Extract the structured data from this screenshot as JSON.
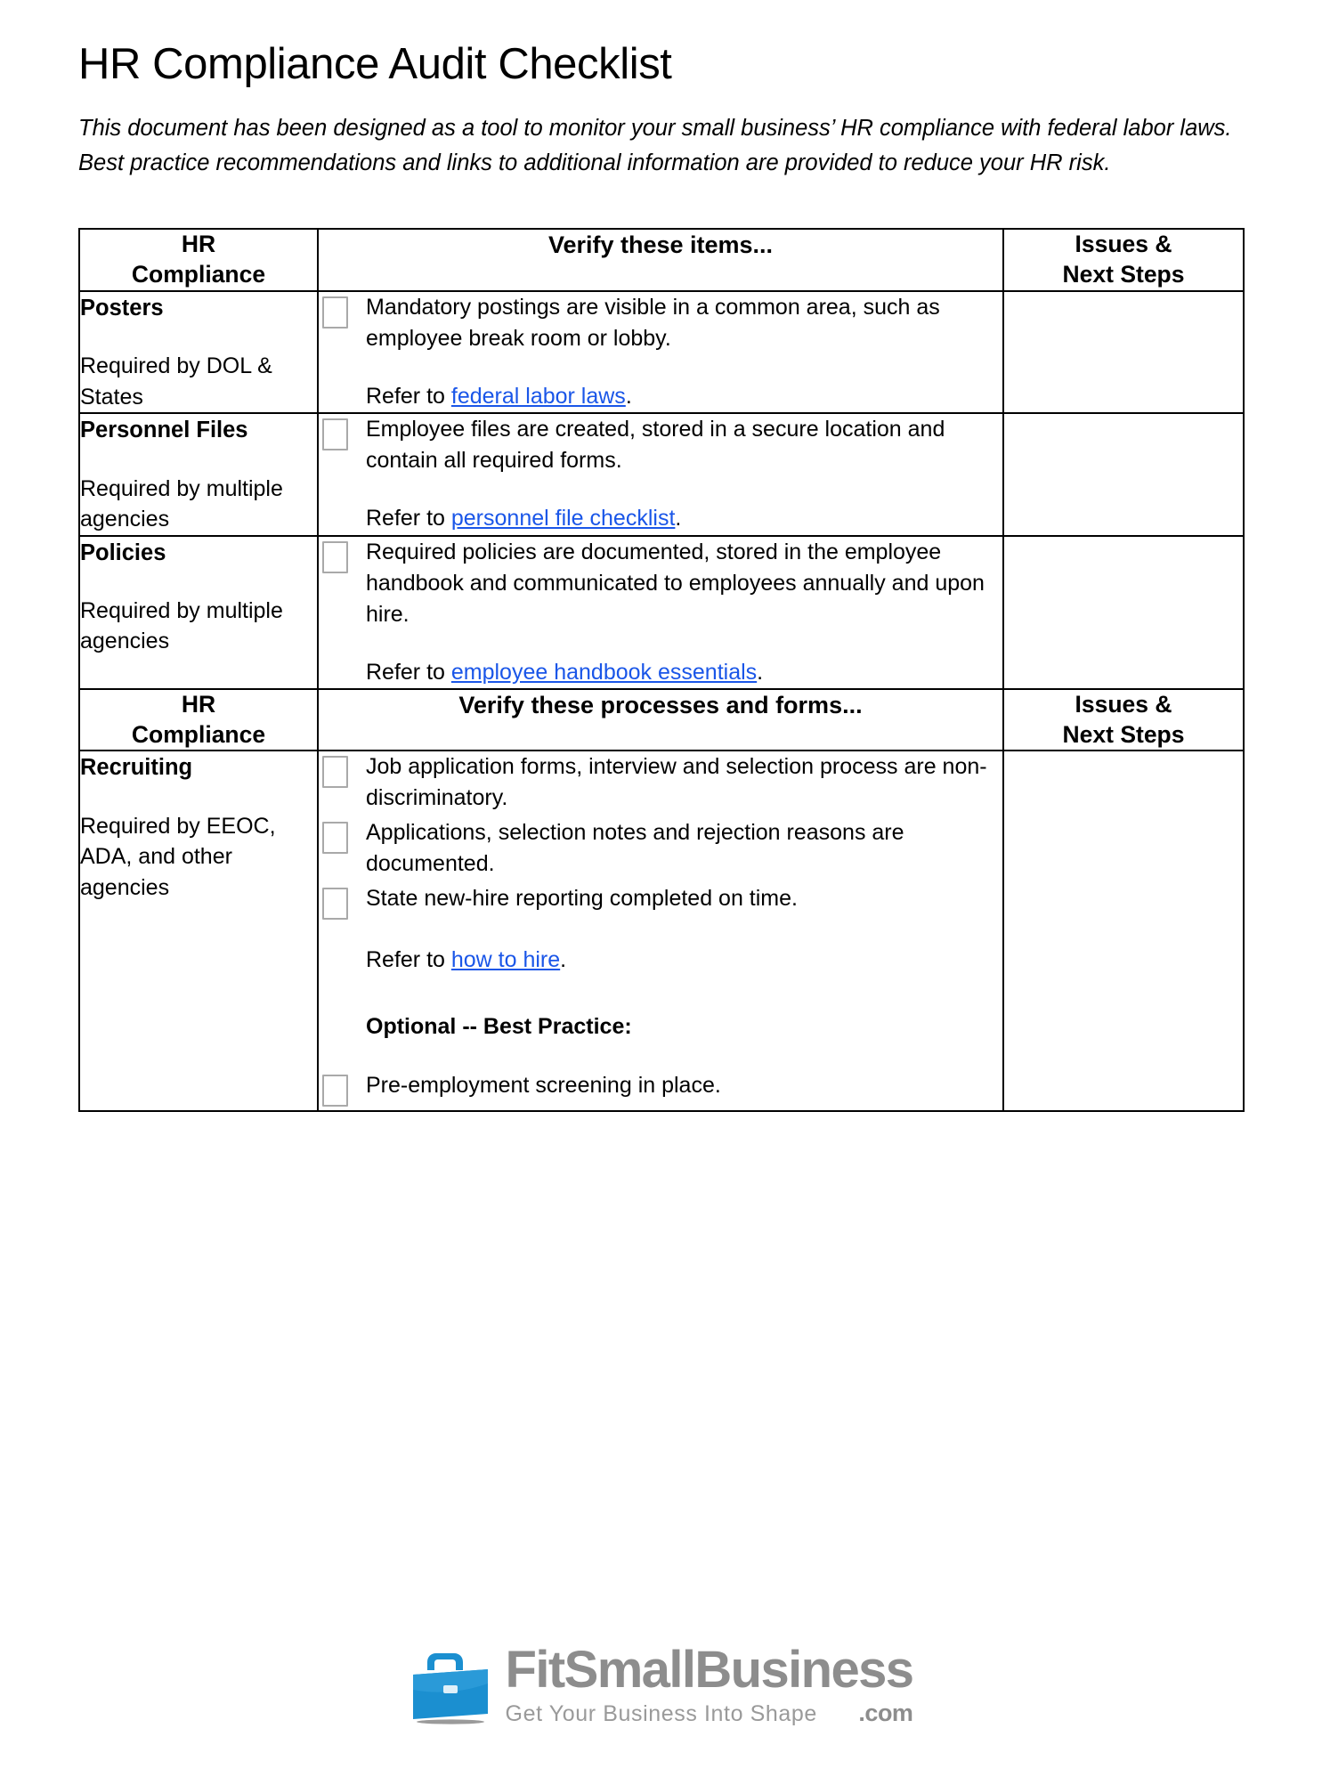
{
  "document": {
    "title": "HR Compliance Audit Checklist",
    "intro": "This document has been designed as a tool to monitor your small business’ HR compliance with federal labor laws. Best practice recommendations and links to additional information are provided to reduce your HR risk."
  },
  "table": {
    "headers_section_1": {
      "category": "HR\nCompliance",
      "category_line1": "HR",
      "category_line2": "Compliance",
      "verify": "Verify these items...",
      "issues_line1": "Issues &",
      "issues_line2": "Next Steps"
    },
    "headers_section_2": {
      "category_line1": "HR",
      "category_line2": "Compliance",
      "verify": "Verify these processes and forms...",
      "issues_line1": "Issues &",
      "issues_line2": "Next Steps"
    },
    "rows": [
      {
        "category_title": "Posters",
        "category_sub": "Required by DOL & States",
        "items": [
          "Mandatory postings are visible in a common area, such as employee break room or lobby."
        ],
        "refer_prefix": "Refer to ",
        "refer_link": "federal labor laws",
        "refer_suffix": "."
      },
      {
        "category_title": "Personnel Files",
        "category_sub": "Required by multiple agencies",
        "items": [
          "Employee files are created, stored in a secure location and contain all required forms."
        ],
        "refer_prefix": "Refer to ",
        "refer_link": "personnel file checklist",
        "refer_suffix": "."
      },
      {
        "category_title": "Policies",
        "category_sub": "Required by multiple agencies",
        "items": [
          "Required policies are documented, stored in the employee handbook and communicated to employees annually and upon hire."
        ],
        "refer_prefix": "Refer to ",
        "refer_link": "employee handbook essentials",
        "refer_suffix": "."
      },
      {
        "category_title": "Recruiting",
        "category_sub": "Required by EEOC, ADA, and other agencies",
        "items": [
          "Job application forms, interview and selection process are non-discriminatory.",
          "Applications, selection notes and rejection reasons are documented.",
          "State new-hire reporting completed on time."
        ],
        "refer_prefix": "Refer to ",
        "refer_link": "how to hire",
        "refer_suffix": ".",
        "optional_heading": "Optional -- Best Practice:",
        "optional_items": [
          "Pre-employment screening in place."
        ]
      }
    ]
  },
  "footer": {
    "logo_fit": "Fit",
    "logo_small": "Small",
    "logo_business": "Business",
    "logo_dotcom": ".com",
    "tagline": "Get Your Business Into Shape"
  },
  "colors": {
    "link": "#1a56e8",
    "logo_blue": "#1b8fd0",
    "logo_gray": "#8d8d8d",
    "border": "#000000",
    "checkbox_border": "#a9a9a9"
  }
}
